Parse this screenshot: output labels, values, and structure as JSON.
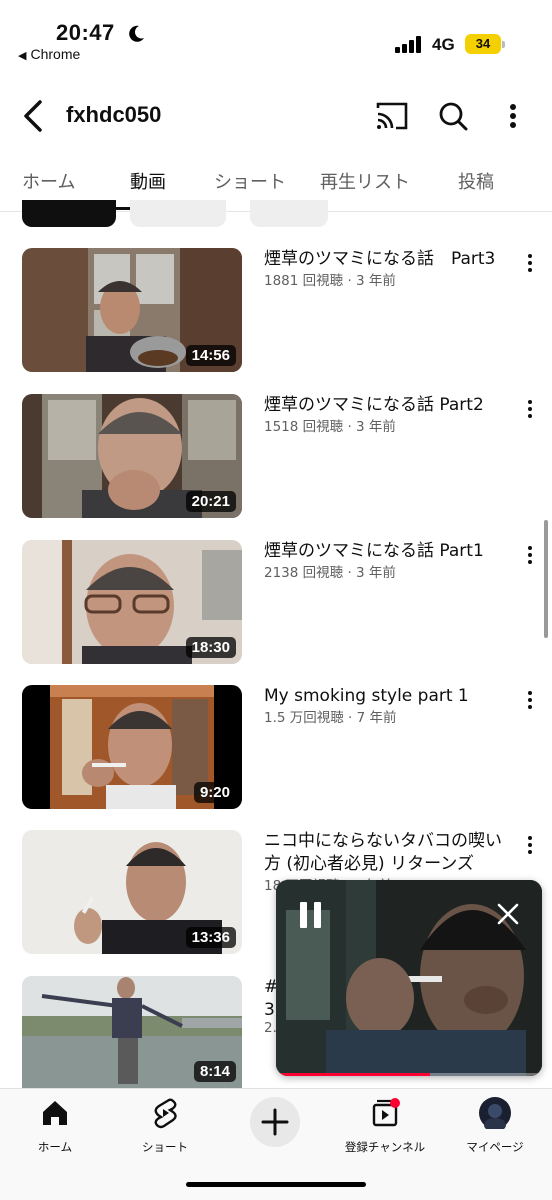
{
  "status_bar": {
    "time": "20:47",
    "back_app": "Chrome",
    "network": "4G",
    "battery": "34",
    "icons": [
      "moon-icon",
      "signal-icon",
      "battery-icon"
    ]
  },
  "header": {
    "channel_name": "fxhdc050",
    "icons": [
      "back-arrow-icon",
      "cast-icon",
      "search-icon",
      "more-vert-icon"
    ]
  },
  "tabs": [
    {
      "label": "ホーム",
      "active": false
    },
    {
      "label": "動画",
      "active": true
    },
    {
      "label": "ショート",
      "active": false
    },
    {
      "label": "再生リスト",
      "active": false
    },
    {
      "label": "投稿",
      "active": false
    }
  ],
  "videos": [
    {
      "title": "煙草のツマミになる話　Part3",
      "meta": "1881 回視聴 · 3 年前",
      "duration": "14:56"
    },
    {
      "title": "煙草のツマミになる話 Part2",
      "meta": "1518 回視聴 · 3 年前",
      "duration": "20:21"
    },
    {
      "title": "煙草のツマミになる話 Part1",
      "meta": "2138 回視聴 · 3 年前",
      "duration": "18:30"
    },
    {
      "title": "My smoking style part 1",
      "meta": "1.5 万回視聴 · 7 年前",
      "duration": "9:20"
    },
    {
      "title": "ニコ中にならないタバコの喫い方 (初心者必見) リターンズ",
      "meta": "18 万回視聴 · 8 年前",
      "duration": "13:36"
    },
    {
      "title": "#",
      "title_line2": "3",
      "meta": "2.",
      "duration": "8:14"
    }
  ],
  "mini_player": {
    "progress_fraction": 0.58,
    "icons": [
      "pause-icon",
      "close-icon"
    ]
  },
  "bottom_nav": [
    {
      "label": "ホーム",
      "icon": "home-icon"
    },
    {
      "label": "ショート",
      "icon": "shorts-icon"
    },
    {
      "label": "",
      "icon": "create-plus-icon"
    },
    {
      "label": "登録チャンネル",
      "icon": "subscriptions-icon"
    },
    {
      "label": "マイページ",
      "icon": "avatar-icon"
    }
  ],
  "colors": {
    "accent_red": "#ff0033",
    "text_primary": "#0f0f0f",
    "text_secondary": "#606060",
    "battery_yellow": "#f5d000"
  }
}
